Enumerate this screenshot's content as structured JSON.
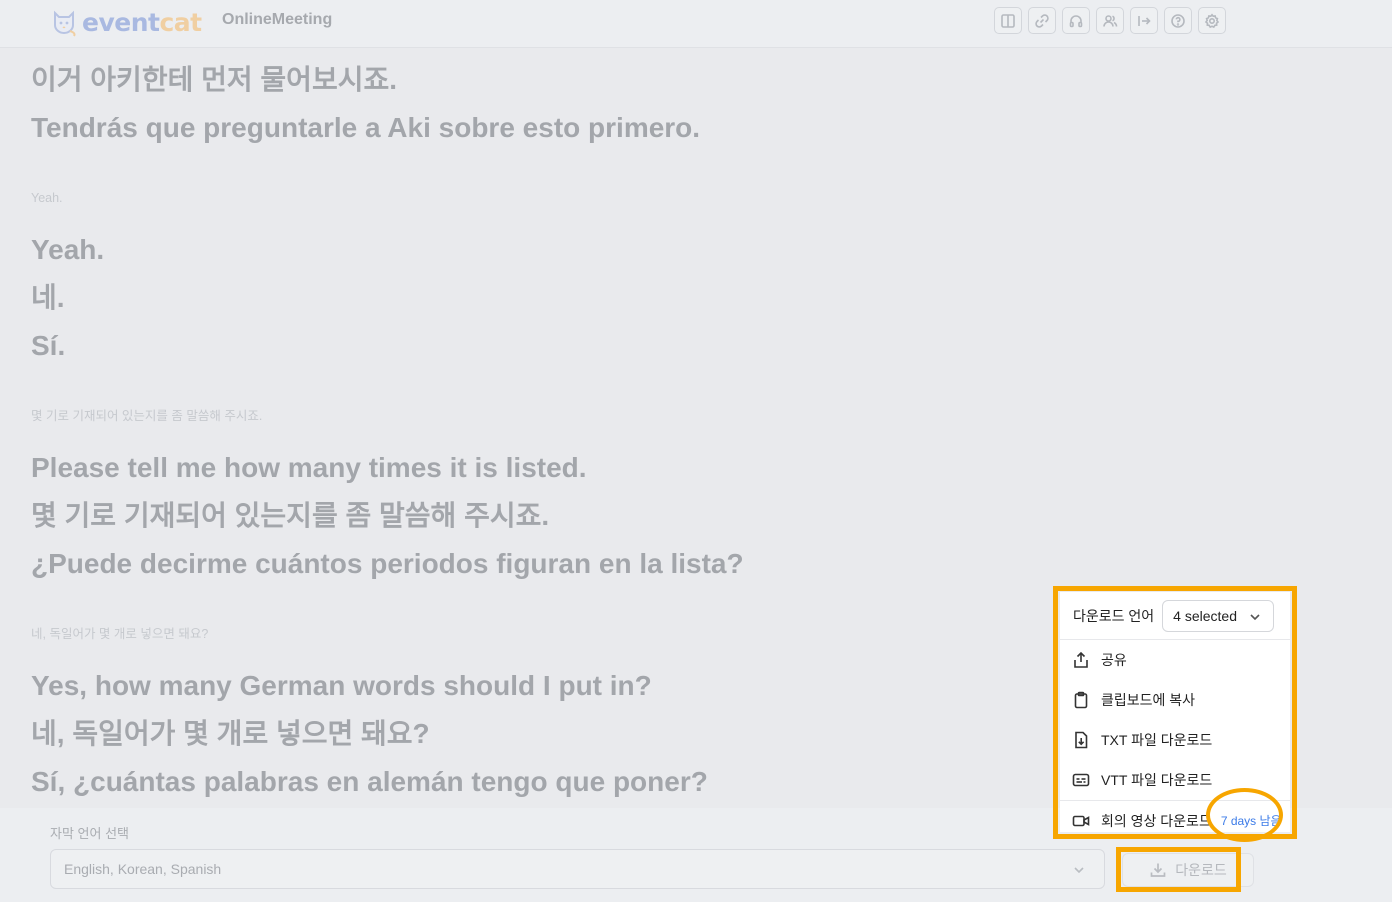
{
  "header": {
    "logo_event": "event",
    "logo_cat": "cat",
    "app_title": "OnlineMeeting",
    "toolbar_icons": [
      "layout-panel-icon",
      "link-icon",
      "headphones-icon",
      "users-icon",
      "exit-icon",
      "help-icon",
      "settings-icon"
    ]
  },
  "transcript": {
    "block1": {
      "lines": [
        "이거 아키한테 먼저 물어보시죠.",
        "Tendrás que preguntarle a Aki sobre esto primero."
      ]
    },
    "block2": {
      "source": "Yeah.",
      "lines": [
        "Yeah.",
        "네.",
        "Sí."
      ]
    },
    "block3": {
      "source": "몇 기로 기재되어 있는지를 좀 말씀해 주시죠.",
      "lines": [
        "Please tell me how many times it is listed.",
        "몇 기로 기재되어 있는지를 좀 말씀해 주시죠.",
        "¿Puede decirme cuántos periodos figuran en la lista?"
      ]
    },
    "block4": {
      "source": "네, 독일어가 몇 개로 넣으면 돼요?",
      "lines": [
        "Yes, how many German words should I put in?",
        "네, 독일어가 몇 개로 넣으면 돼요?",
        "Sí, ¿cuántas palabras en alemán tengo que poner?"
      ]
    }
  },
  "bottom": {
    "subtitle_label": "자막 언어 선택",
    "subtitle_value": "English, Korean, Spanish",
    "download_label": "다운로드"
  },
  "menu": {
    "lang_label": "다운로드 언어",
    "lang_selected": "4 selected",
    "items": [
      {
        "label": "공유",
        "icon": "share-icon"
      },
      {
        "label": "클립보드에 복사",
        "icon": "clipboard-icon"
      },
      {
        "label": "TXT 파일 다운로드",
        "icon": "file-download-icon"
      },
      {
        "label": "VTT 파일 다운로드",
        "icon": "captions-icon"
      },
      {
        "label": "회의 영상 다운로드",
        "icon": "video-icon"
      }
    ],
    "days_left": "7 days 남음"
  },
  "colors": {
    "highlight": "#f7a600",
    "accent_blue": "#3b7be8"
  }
}
